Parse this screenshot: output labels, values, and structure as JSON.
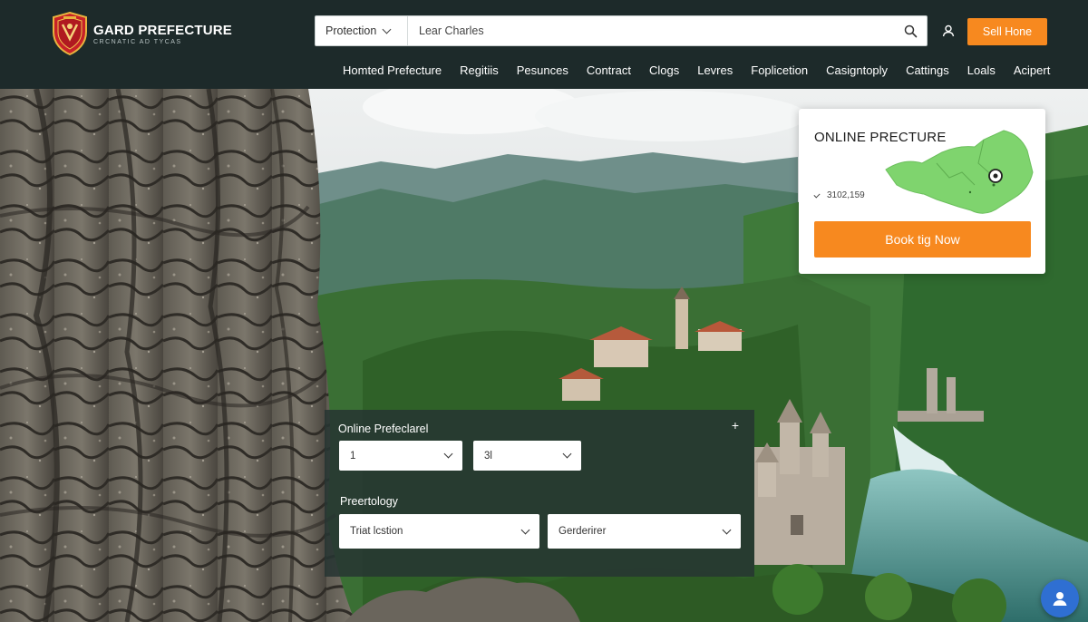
{
  "header": {
    "brand_name": "GARD PREFECTURE",
    "brand_tagline": "CRCNATIC AD TYCAS",
    "search": {
      "category": "Protection",
      "query": "Lear Charles"
    },
    "cta_label": "Sell Hone"
  },
  "nav": {
    "items": [
      "Homted Prefecture",
      "Regitiis",
      "Pesunces",
      "Contract",
      "Clogs",
      "Levres",
      "Foplicetion",
      "Casigntoply",
      "Cattings",
      "Loals",
      "Acipert"
    ]
  },
  "booking_card": {
    "title": "ONLINE PRECTURE",
    "price": "3102,159",
    "button_label": "Book tig Now"
  },
  "filter_panel": {
    "title": "Online Prefeclarel",
    "select_1": "1",
    "select_2": "3l",
    "subtitle": "Preertology",
    "select_3": "Triat lcstion",
    "select_4": "Gerderirer"
  },
  "colors": {
    "header_bg": "#1d2a2a",
    "accent_orange": "#f7891f",
    "chat_blue": "#2f6fd2",
    "map_green": "#7fd46e"
  },
  "icons": {
    "logo": "shield-crest-icon",
    "search": "search-icon",
    "user": "user-icon",
    "chevron": "chevron-down-icon",
    "check": "check-icon",
    "plus": "plus-icon",
    "chat": "chat-support-icon",
    "map_pin": "map-pin-icon"
  }
}
